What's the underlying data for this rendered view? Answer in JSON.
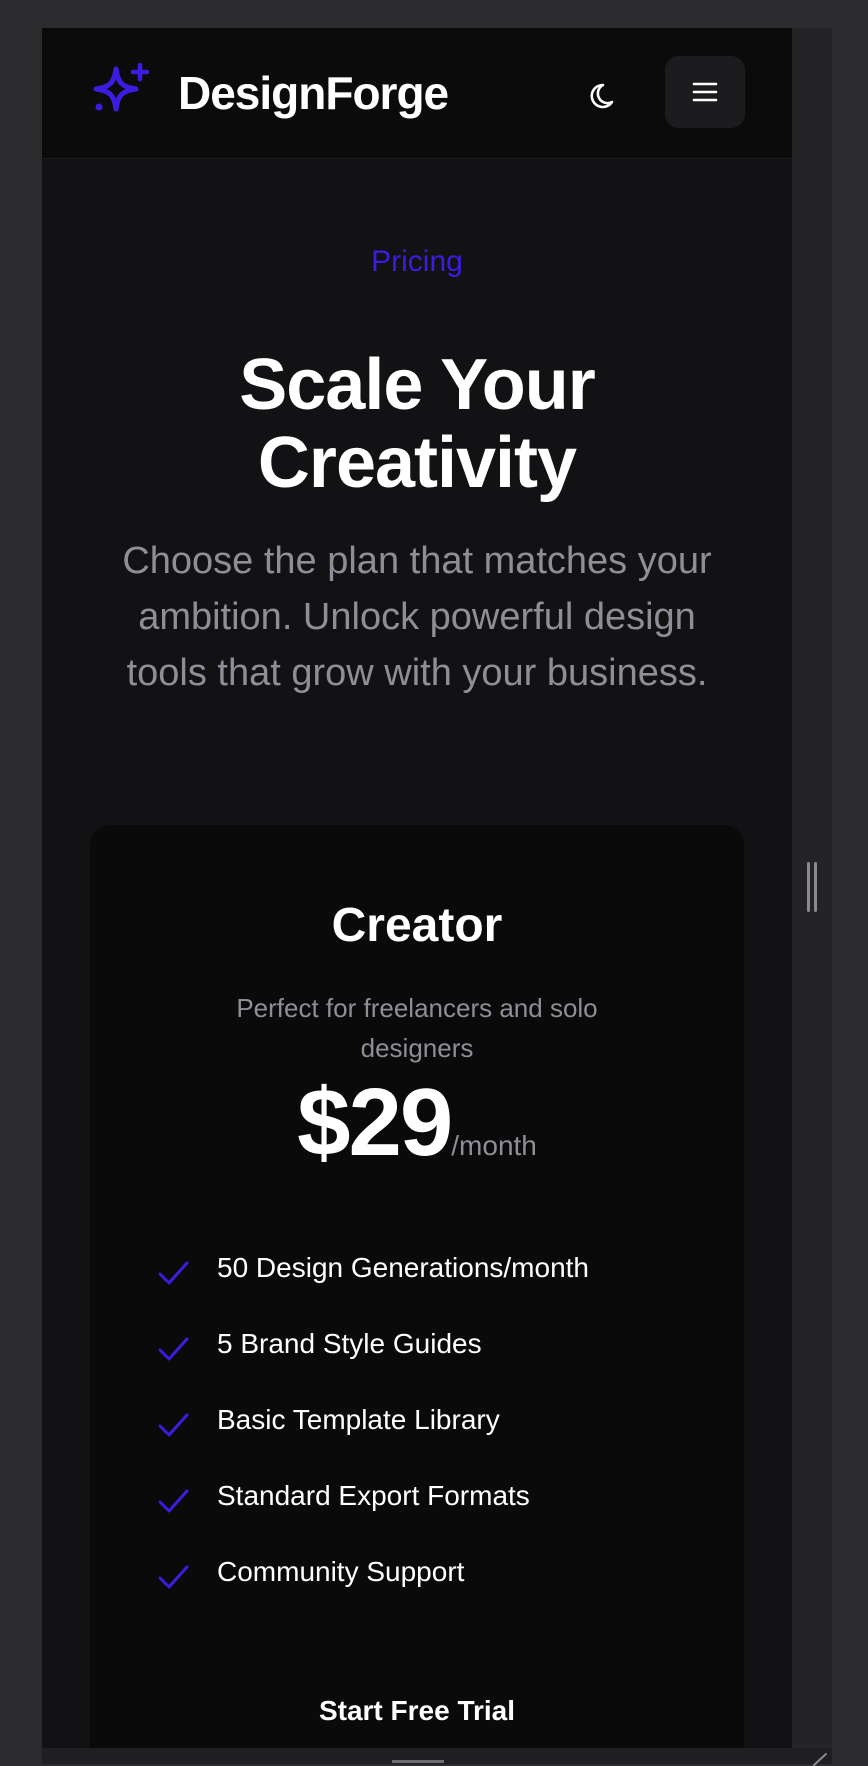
{
  "header": {
    "brand": "DesignForge",
    "logo_icon": "sparkle-icon",
    "theme_icon": "moon-icon",
    "menu_icon": "hamburger-menu-icon"
  },
  "hero": {
    "eyebrow": "Pricing",
    "title": "Scale Your Creativity",
    "subtitle": "Choose the plan that matches your ambition. Unlock powerful design tools that grow with your business."
  },
  "plan": {
    "name": "Creator",
    "description": "Perfect for freelancers and solo designers",
    "price": "$29",
    "period": "/month",
    "features": [
      "50 Design Generations/month",
      "5 Brand Style Guides",
      "Basic Template Library",
      "Standard Export Formats",
      "Community Support"
    ],
    "cta_label": "Start Free Trial"
  },
  "colors": {
    "accent": "#3a1de0",
    "background": "#121214",
    "card": "#0a0a0b",
    "muted_text": "#8e8e96"
  }
}
